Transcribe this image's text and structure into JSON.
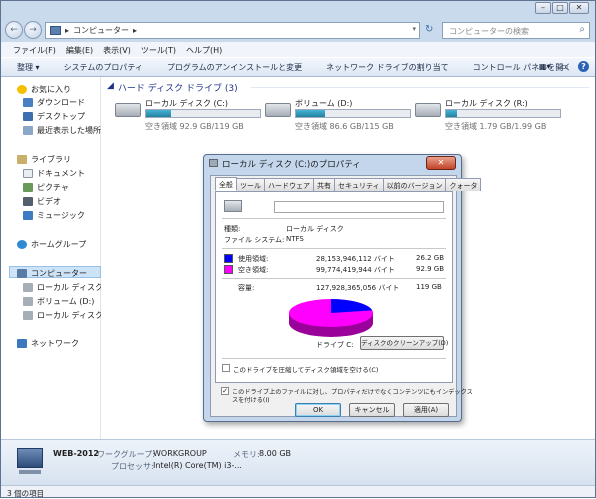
{
  "window": {
    "caption_min": "–",
    "caption_max": "□",
    "caption_close": "✕"
  },
  "address": {
    "back": "←",
    "forward": "→",
    "path": "コンピューター",
    "sep": "▸",
    "search_placeholder": "コンピューターの検索"
  },
  "menu": [
    "ファイル(F)",
    "編集(E)",
    "表示(V)",
    "ツール(T)",
    "ヘルプ(H)"
  ],
  "toolbar": [
    "整理 ▾",
    "システムのプロパティ",
    "プログラムのアンインストールと変更",
    "ネットワーク ドライブの割り当て",
    "コントロール パネルを開く"
  ],
  "sidebar": {
    "favorites": "お気に入り",
    "downloads": "ダウンロード",
    "desktop": "デスクトップ",
    "recent": "最近表示した場所",
    "libraries": "ライブラリ",
    "documents": "ドキュメント",
    "pictures": "ピクチャ",
    "videos": "ビデオ",
    "music": "ミュージック",
    "homegroup": "ホームグループ",
    "computer": "コンピューター",
    "local_c": "ローカル ディスク (",
    "volume_d": "ボリューム (D:)",
    "local_r": "ローカル ディスク (",
    "network": "ネットワーク"
  },
  "group_header": "ハード ディスク ドライブ (3)",
  "drives": [
    {
      "name": "ローカル ディスク (C:)",
      "free": "空き領域 92.9 GB/119 GB",
      "used_fraction": 0.22
    },
    {
      "name": "ボリューム (D:)",
      "free": "空き領域 86.6 GB/115 GB",
      "used_fraction": 0.25
    },
    {
      "name": "ローカル ディスク (R:)",
      "free": "空き領域 1.79 GB/1.99 GB",
      "used_fraction": 0.1
    }
  ],
  "details": {
    "computer_name": "WEB-2012",
    "workgroup_label": "ワークグループ:",
    "workgroup": "WORKGROUP",
    "memory_label": "メモリ:",
    "memory": "8.00 GB",
    "processor_label": "プロセッサ:",
    "processor": "Intel(R) Core(TM) i3-..."
  },
  "statusbar": "3 個の項目",
  "dialog": {
    "title": "ローカル ディスク (C:)のプロパティ",
    "close": "✕",
    "tabs": [
      "全般",
      "ツール",
      "ハードウェア",
      "共有",
      "セキュリティ",
      "以前のバージョン",
      "クォータ"
    ],
    "type_label": "種類:",
    "type_value": "ローカル ディスク",
    "fs_label": "ファイル システム:",
    "fs_value": "NTFS",
    "used_label": "使用領域:",
    "used_bytes": "28,153,946,112 バイト",
    "used_gb": "26.2 GB",
    "free_label": "空き領域:",
    "free_bytes": "99,774,419,944 バイト",
    "free_gb": "92.9 GB",
    "cap_label": "容量:",
    "cap_bytes": "127,928,365,056 バイト",
    "cap_gb": "119 GB",
    "drive_label": "ドライブ C:",
    "cleanup": "ディスクのクリーンアップ(D)",
    "compress": "このドライブを圧縮してディスク領域を空ける(C)",
    "index_1": "このドライブ上のファイルに対し、プロパティだけでなくコンテンツにもインデックス",
    "index_2": "スを付ける(I)",
    "ok": "OK",
    "cancel": "キャンセル",
    "apply": "適用(A)",
    "used_fraction": 0.22
  },
  "colors": {
    "used": "#0000ff",
    "free": "#ff00ff"
  }
}
